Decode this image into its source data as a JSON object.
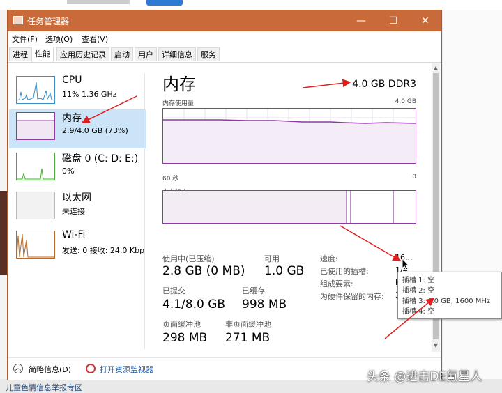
{
  "window": {
    "title": "任务管理器"
  },
  "menu": [
    "文件(F)",
    "选项(O)",
    "查看(V)"
  ],
  "tabs": [
    "进程",
    "性能",
    "应用历史记录",
    "启动",
    "用户",
    "详细信息",
    "服务"
  ],
  "resources": [
    {
      "name": "CPU",
      "sub": "11% 1.36 GHz"
    },
    {
      "name": "内存",
      "sub": "2.9/4.0 GB (73%)"
    },
    {
      "name": "磁盘 0 (C: D: E:)",
      "sub": "0%"
    },
    {
      "name": "以太网",
      "sub": "未连接"
    },
    {
      "name": "Wi-Fi",
      "sub": "发送: 0 接收: 24.0 Kbp"
    }
  ],
  "memory": {
    "title": "内存",
    "type": "4.0 GB DDR3",
    "usage_label": "内存使用量",
    "usage_max": "4.0 GB",
    "time_label": "60 秒",
    "time_end": "0",
    "composition_label": "内存组合",
    "stats": {
      "in_use_label": "使用中(已压缩)",
      "in_use": "2.8 GB (0 MB)",
      "available_label": "可用",
      "available": "1.0 GB",
      "committed_label": "已提交",
      "committed": "4.1/8.0 GB",
      "cached_label": "已缓存",
      "cached": "998 MB",
      "paged_label": "页面缓冲池",
      "paged": "298 MB",
      "nonpaged_label": "非页面缓冲池",
      "nonpaged": "271 MB"
    },
    "right_stats": {
      "speed_label": "速度:",
      "speed": "16...",
      "slots_label": "已使用的插槽:",
      "slots": "1/4",
      "form_label": "组成要素:",
      "form": "D",
      "reserved_label": "为硬件保留的内存:",
      "reserved": "3"
    }
  },
  "tooltip": [
    "插槽 1: 空",
    "插槽 2: 空",
    "插槽 3: 4.0 GB, 1600 MHz",
    "插槽 4: 空"
  ],
  "footer": {
    "less": "简略信息(D)",
    "monitor": "打开资源监视器"
  },
  "background": {
    "bottom_text": "儿童色情信息举报专区",
    "watermark": "头条 @进击DE氪星人"
  },
  "colors": {
    "titlebar": "#c86a3a",
    "memory_graph": "#8a3aa0",
    "selected": "#cce4f7",
    "annotation_arrow": "#e02020"
  }
}
